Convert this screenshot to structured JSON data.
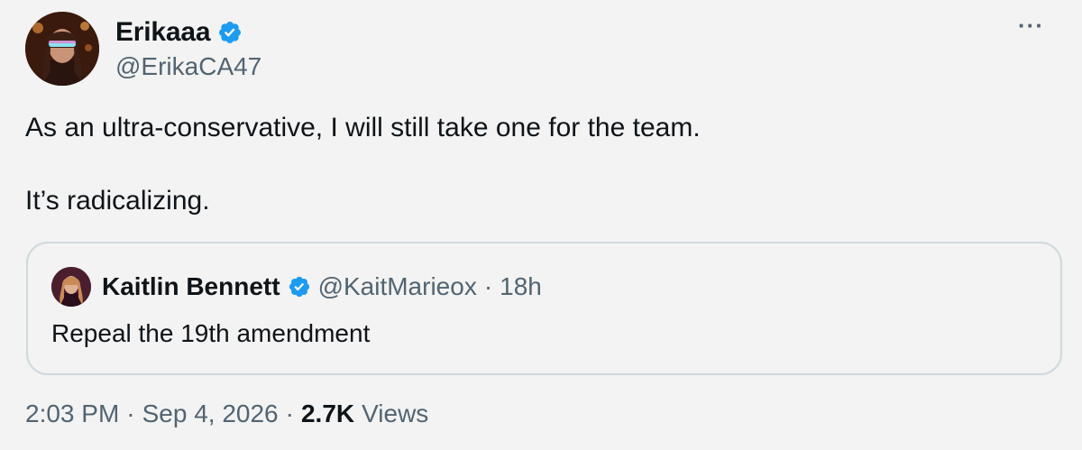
{
  "author": {
    "name": "Erikaaa",
    "handle": "@ErikaCA47",
    "verified_color": "#1d9bf0"
  },
  "more_label": "···",
  "tweet": {
    "line1": "As an ultra-conservative, I will still take one for the team.",
    "line2": "It’s radicalizing."
  },
  "quoted": {
    "name": "Kaitlin Bennett",
    "handle": "@KaitMarieox",
    "separator": "·",
    "time": "18h",
    "text": "Repeal the 19th amendment"
  },
  "meta": {
    "time": "2:03 PM",
    "sep1": "·",
    "date": "Sep 4, 2026",
    "sep2": "·",
    "views_count": "2.7K",
    "views_label": "Views"
  },
  "colors": {
    "background": "#f2f3f2",
    "text_primary": "#0f1419",
    "text_secondary": "#536471",
    "border": "#cfd9de",
    "verified": "#1d9bf0"
  }
}
